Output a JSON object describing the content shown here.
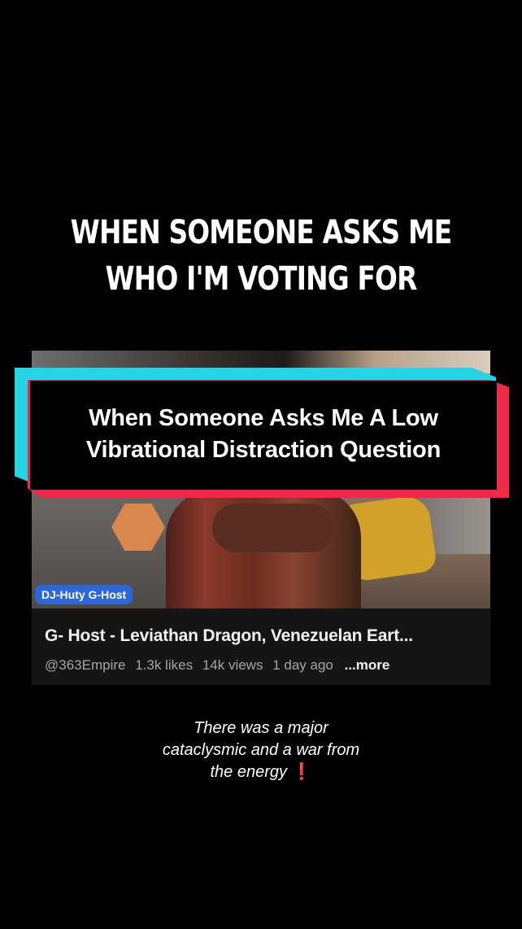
{
  "headline": {
    "line1": "WHEN SOMEONE ASKS ME",
    "line2": "WHO I'M VOTING FOR"
  },
  "banner": {
    "line1": "When Someone Asks Me A Low",
    "line2": "Vibrational Distraction Question",
    "colors": {
      "cyan": "#27d4e6",
      "red": "#f2284a"
    }
  },
  "video": {
    "channel_tag": "DJ-Huty G-Host",
    "title": "G- Host - Leviathan Dragon, Venezuelan Eart...",
    "handle": "@363Empire",
    "likes": "1.3k likes",
    "views": "14k views",
    "age": "1 day ago",
    "more_label": "...more"
  },
  "caption": {
    "line1": "There was a major",
    "line2": "cataclysmic and a war from",
    "line3": "the energy",
    "emoji": "❗"
  }
}
